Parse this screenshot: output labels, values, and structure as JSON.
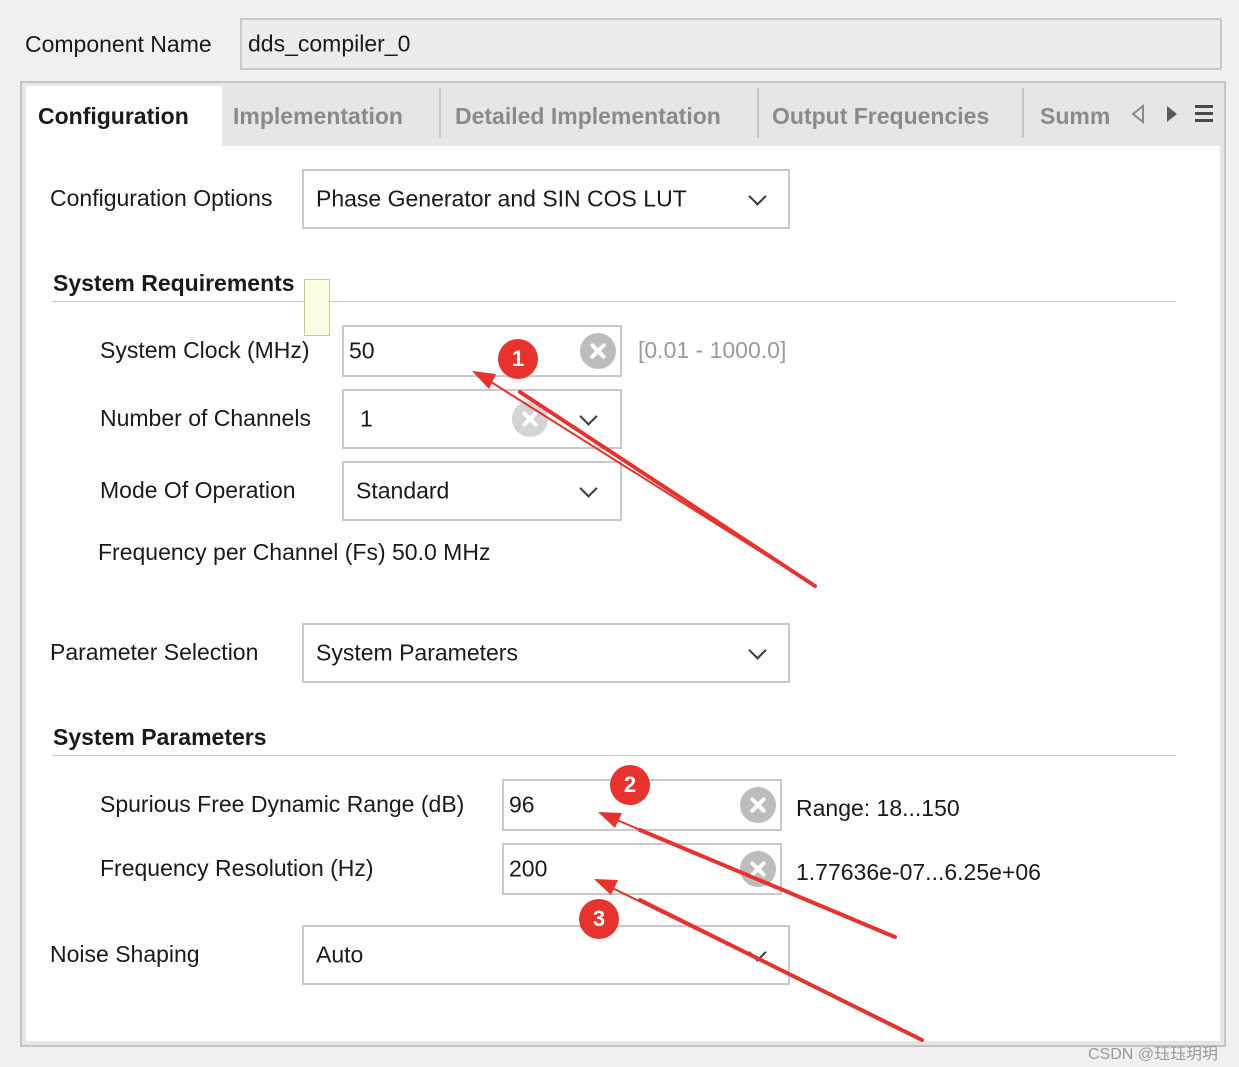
{
  "component": {
    "label": "Component Name",
    "value": "dds_compiler_0"
  },
  "tabs": [
    {
      "label": "Configuration"
    },
    {
      "label": "Implementation"
    },
    {
      "label": "Detailed Implementation"
    },
    {
      "label": "Output Frequencies"
    },
    {
      "label": "Summ"
    }
  ],
  "config_options": {
    "label": "Configuration Options",
    "value": "Phase Generator and SIN COS LUT"
  },
  "system_requirements": {
    "title": "System Requirements",
    "system_clock": {
      "label": "System Clock (MHz)",
      "value": "50",
      "range": "[0.01 - 1000.0]"
    },
    "num_channels": {
      "label": "Number of Channels",
      "value": "1"
    },
    "mode": {
      "label": "Mode Of Operation",
      "value": "Standard"
    },
    "freq_per_channel": "Frequency per Channel (Fs) 50.0 MHz"
  },
  "parameter_selection": {
    "label": "Parameter Selection",
    "value": "System Parameters"
  },
  "system_parameters": {
    "title": "System Parameters",
    "sfdr": {
      "label": "Spurious Free Dynamic Range (dB)",
      "value": "96",
      "range": "Range: 18...150"
    },
    "freq_res": {
      "label": "Frequency Resolution (Hz)",
      "value": "200",
      "range": "1.77636e-07...6.25e+06"
    }
  },
  "noise_shaping": {
    "label": "Noise Shaping",
    "value": "Auto"
  },
  "annotations": [
    "1",
    "2",
    "3"
  ],
  "watermark": "CSDN @珏珏玥玥",
  "colors": {
    "annotation": "#e8322e",
    "panel": "#ffffff",
    "background": "#f0f0f0"
  },
  "icons": {
    "tab_prev": "triangle-left-icon",
    "tab_next": "triangle-right-icon",
    "tab_menu": "hamburger-menu-icon",
    "clear": "clear-circle-icon",
    "dropdown": "chevron-down-icon"
  }
}
